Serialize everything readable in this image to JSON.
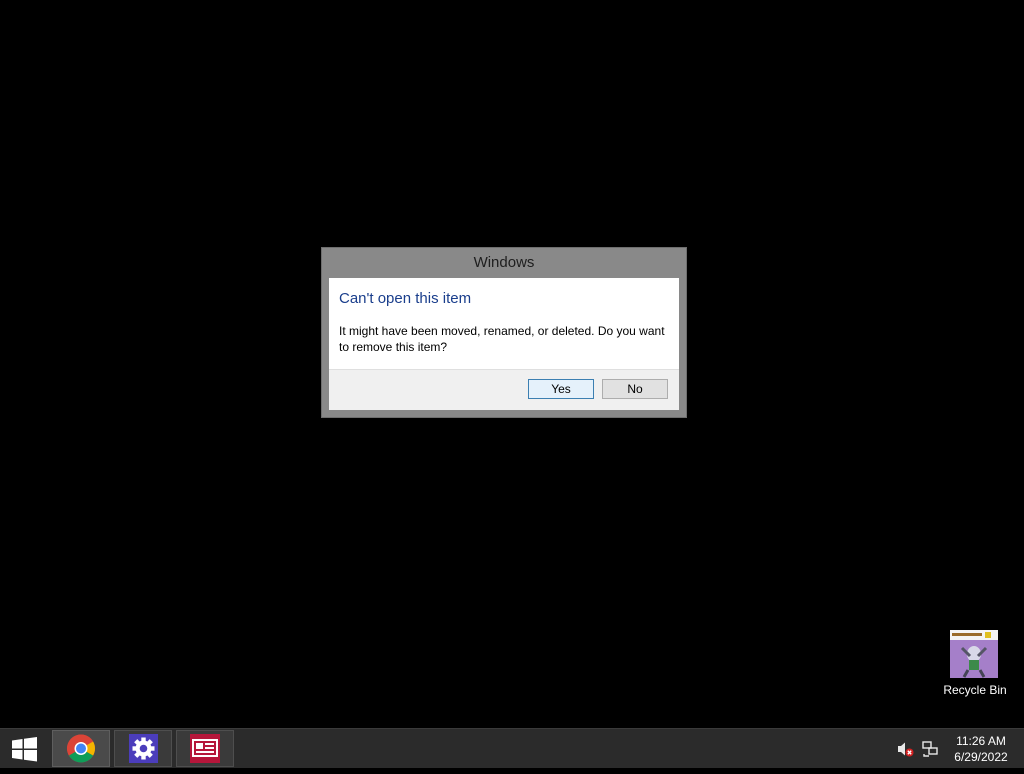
{
  "dialog": {
    "title": "Windows",
    "heading": "Can't open this item",
    "message": "It might have been moved, renamed, or deleted. Do you want to remove this item?",
    "yes_label": "Yes",
    "no_label": "No"
  },
  "desktop": {
    "icons": [
      {
        "label": "Recycle Bin",
        "icon": "recycle-bin-icon"
      }
    ]
  },
  "taskbar": {
    "start_icon": "windows-logo-icon",
    "pinned": [
      {
        "name": "Google Chrome",
        "icon": "chrome-icon"
      },
      {
        "name": "Settings",
        "icon": "gear-icon",
        "accent": "#4b3dbb"
      },
      {
        "name": "News",
        "icon": "news-icon",
        "accent": "#b5163a"
      }
    ],
    "tray": {
      "volume_icon": "volume-muted-icon",
      "network_icon": "network-icon",
      "time": "11:26 AM",
      "date": "6/29/2022"
    }
  },
  "colors": {
    "desktop_background": "#000000",
    "taskbar": "#2b2b2b",
    "dialog_frame": "#898989",
    "heading_text": "#1a3e8c",
    "default_button_border": "#3c7fb1"
  }
}
